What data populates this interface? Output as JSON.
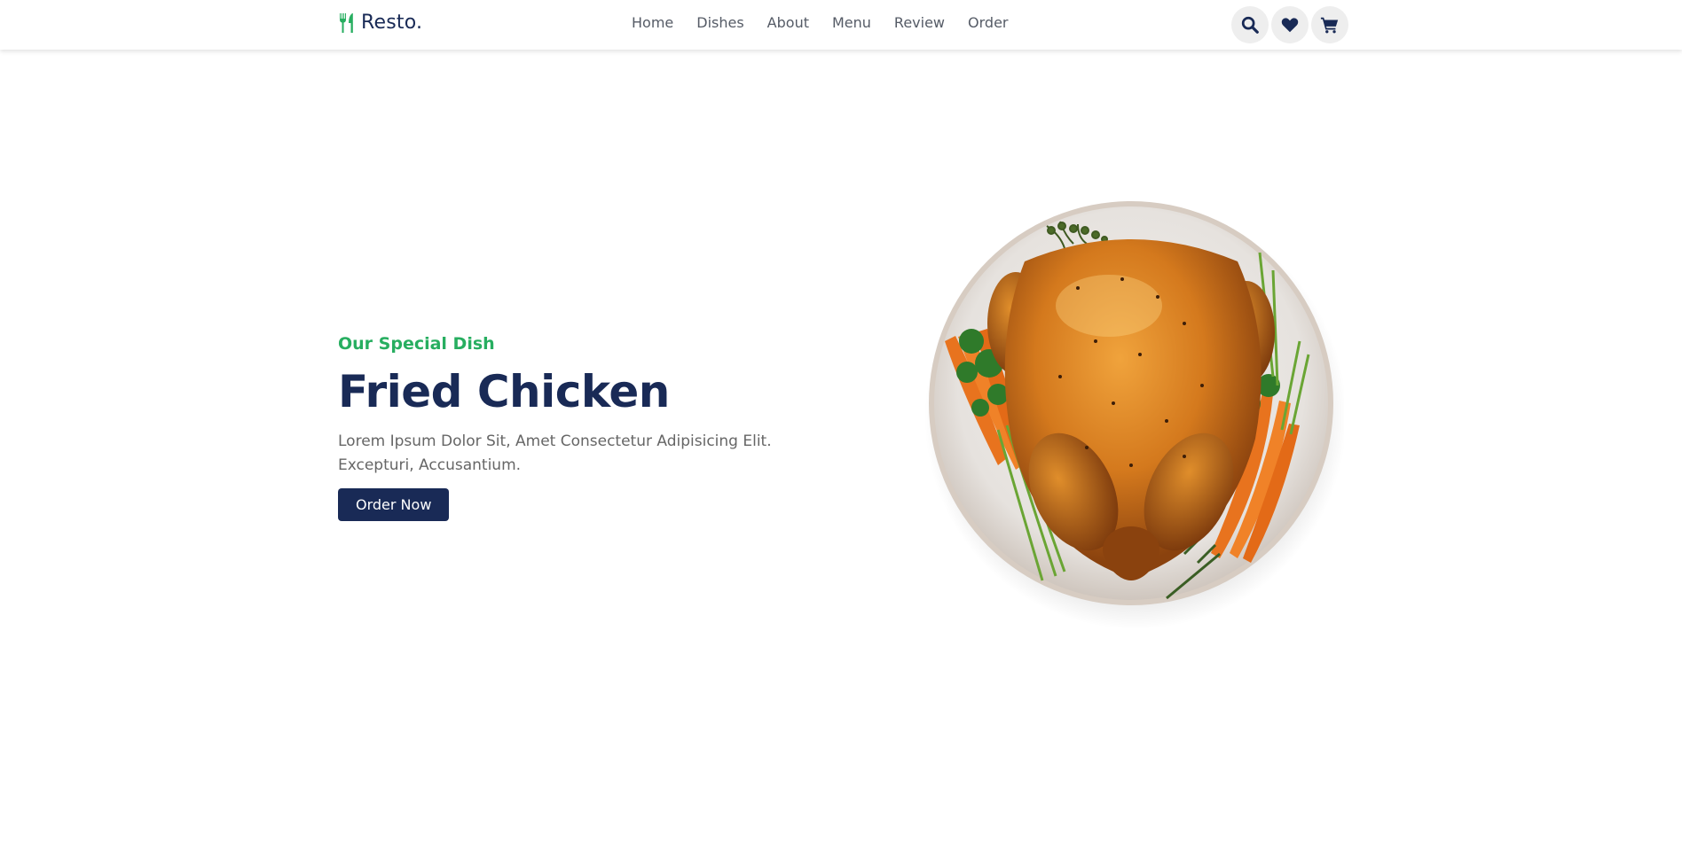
{
  "header": {
    "brand": "Resto.",
    "nav": [
      "Home",
      "Dishes",
      "About",
      "Menu",
      "Review",
      "Order"
    ],
    "icons": [
      "search-icon",
      "heart-icon",
      "cart-icon"
    ]
  },
  "hero": {
    "subtitle": "Our Special Dish",
    "title": "Fried Chicken",
    "description": "Lorem Ipsum Dolor Sit, Amet Consectetur Adipisicing Elit. Excepturi, Accusantium.",
    "button": "Order Now",
    "image": "roast-chicken-plate"
  },
  "colors": {
    "accent": "#27ae60",
    "primary": "#192a56",
    "text": "#666666",
    "icon_bg": "#eeeeee"
  }
}
